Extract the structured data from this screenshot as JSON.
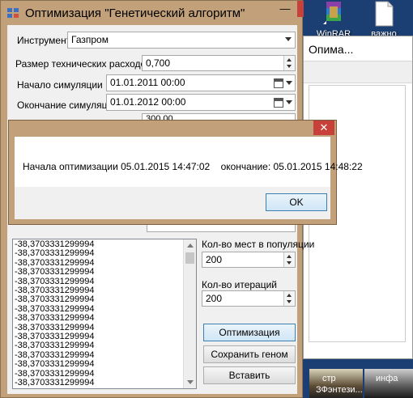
{
  "desktop": {
    "icons": [
      {
        "label": "WinRAR",
        "icon": "winrar-icon"
      },
      {
        "label": "важно",
        "icon": "document-icon"
      }
    ],
    "background_window": {
      "title": "Опима..."
    },
    "taskbar_thumbs": [
      {
        "label": "стр",
        "sub": "ЗФэнтези..."
      },
      {
        "label": "инфа"
      }
    ]
  },
  "window": {
    "title": "Оптимизация \"Генетический алгоритм\"",
    "min_symbol": "—",
    "close_symbol": "✕",
    "fields": {
      "instrument_label": "Инструмент",
      "instrument_value": "Газпром",
      "costs_label": "Размер технических расходов, %",
      "costs_value": "0,700",
      "start_label": "Начало симуляции",
      "start_value": "01.01.2011 00:00",
      "end_label": "Окончание симуляции",
      "end_value": "01.01.2012 00:00",
      "hidden_value": "300,00",
      "population_label": "Кол-во мест в популяции",
      "population_value": "200",
      "iterations_label": "Кол-во итераций",
      "iterations_value": "200"
    },
    "log_rows": [
      "-38,3703331299994",
      "-38,3703331299994",
      "-38,3703331299994",
      "-38,3703331299994",
      "-38,3703331299994",
      "-38,3703331299994",
      "-38,3703331299994",
      "-38,3703331299994",
      "-38,3703331299994",
      "-38,3703331299994",
      "-38,3703331299994",
      "-38,3703331299994",
      "-38,3703331299994",
      "-38,3703331299994",
      "-38,3703331299994",
      "-38,3703331299994"
    ],
    "buttons": {
      "optimize": "Оптимизация",
      "save_genome": "Сохранить геном",
      "paste": "Вставить"
    }
  },
  "message_box": {
    "close_symbol": "✕",
    "message": "Начала оптимизации 05.01.2015 14:47:02    окончание: 05.01.2015 14:48:22",
    "ok_label": "OK"
  }
}
